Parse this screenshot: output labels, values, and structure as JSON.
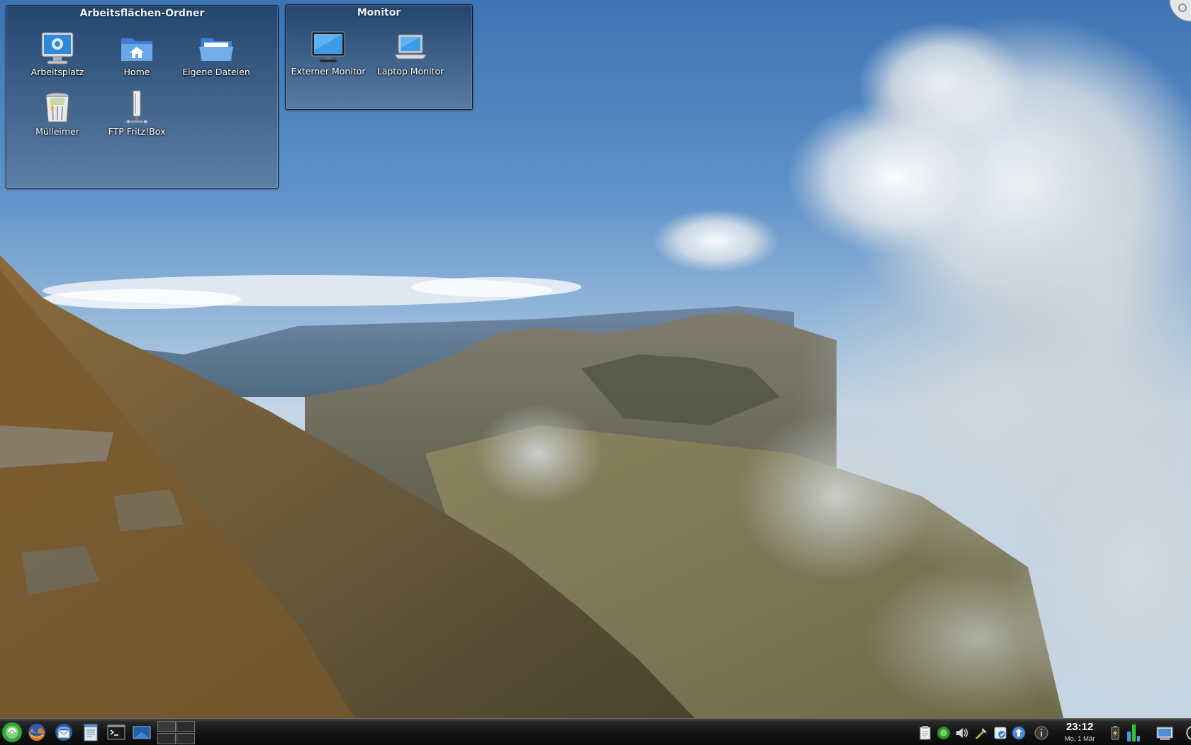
{
  "desktop": {
    "folder_widget": {
      "title": "Arbeitsflächen-Ordner",
      "icons": [
        {
          "label": "Arbeitsplatz",
          "icon": "computer-icon"
        },
        {
          "label": "Home",
          "icon": "home-folder-icon"
        },
        {
          "label": "Eigene Dateien",
          "icon": "folder-open-icon"
        },
        {
          "label": "Mülleimer",
          "icon": "trash-icon"
        },
        {
          "label": "FTP Fritz!Box",
          "icon": "network-server-icon"
        }
      ]
    },
    "monitor_widget": {
      "title": "Monitor",
      "icons": [
        {
          "label": "Externer Monitor",
          "icon": "monitor-icon"
        },
        {
          "label": "Laptop Monitor",
          "icon": "laptop-icon"
        }
      ]
    }
  },
  "taskbar": {
    "launchers": [
      "kickoff-menu-icon",
      "firefox-icon",
      "thunderbird-icon",
      "text-editor-icon",
      "terminal-icon",
      "desktop-icon",
      "pager-icon"
    ],
    "tray_icons": [
      "clipboard-icon",
      "updater-icon",
      "volume-icon",
      "network-icon",
      "kde-connect-icon",
      "package-icon",
      "info-icon"
    ],
    "clock": {
      "time": "23:12",
      "date": "Mo, 1 Mär"
    },
    "right_icons": [
      "battery-icon",
      "system-monitor-icon",
      "screen-icon",
      "cashew-icon"
    ]
  },
  "colors": {
    "panel_bg": "#141414",
    "widget_bg": "#3b5878",
    "sky": "#5a8cc4",
    "label_text": "#ffffff"
  }
}
